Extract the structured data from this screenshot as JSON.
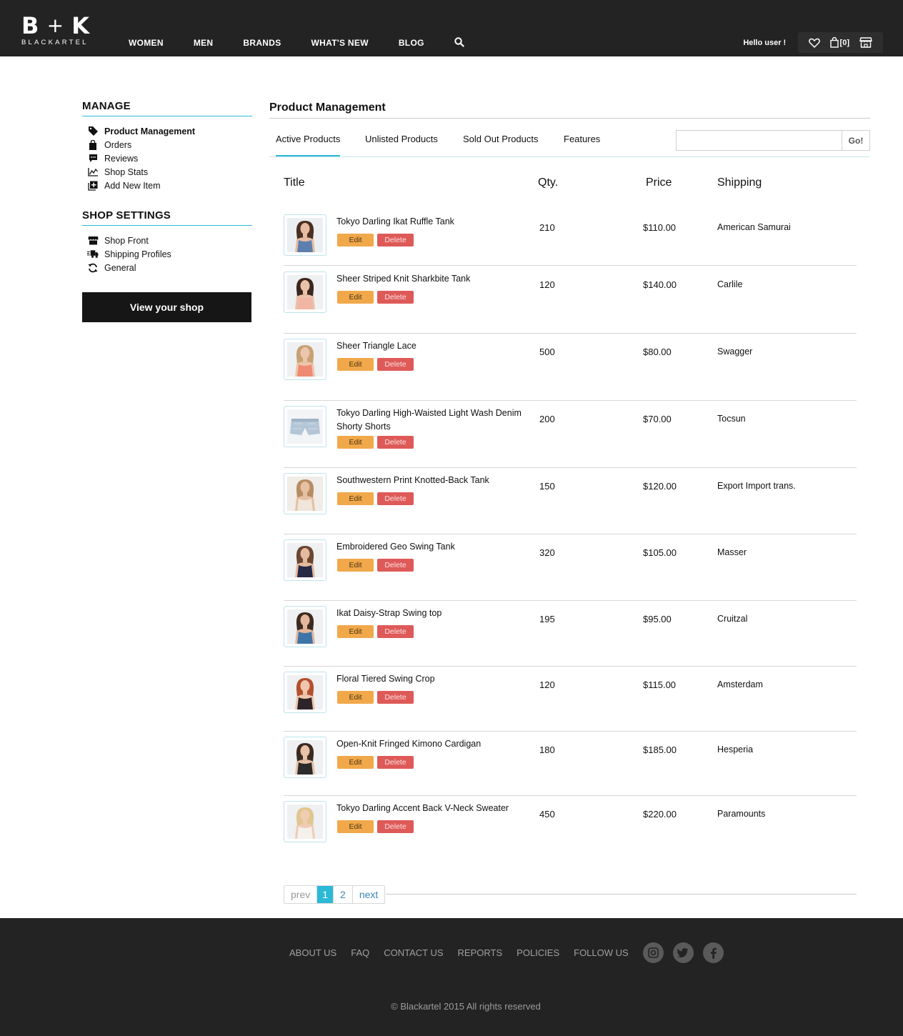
{
  "brand": {
    "mark_left": "B",
    "mark_plus": "+",
    "mark_right": "K",
    "wordmark": "BLACKARTEL"
  },
  "nav": {
    "items": [
      "WOMEN",
      "MEN",
      "BRANDS",
      "WHAT'S NEW",
      "BLOG"
    ],
    "search_icon": "search-icon"
  },
  "user": {
    "greeting": "Hello user !",
    "cart_count": "[0]"
  },
  "sidebar": {
    "manage_title": "MANAGE",
    "manage_items": [
      {
        "label": "Product Management",
        "icon": "tag-icon",
        "active": true
      },
      {
        "label": "Orders",
        "icon": "bag-icon"
      },
      {
        "label": "Reviews",
        "icon": "chat-icon"
      },
      {
        "label": "Shop Stats",
        "icon": "chart-icon"
      },
      {
        "label": "Add New Item",
        "icon": "add-icon"
      }
    ],
    "settings_title": "SHOP SETTINGS",
    "settings_items": [
      {
        "label": "Shop Front",
        "icon": "storefront-icon"
      },
      {
        "label": "Shipping Profiles",
        "icon": "truck-icon"
      },
      {
        "label": "General",
        "icon": "refresh-icon"
      }
    ],
    "view_shop_label": "View your shop"
  },
  "main": {
    "title": "Product Management",
    "tabs": [
      "Active Products",
      "Unlisted Products",
      "Sold Out Products",
      "Features"
    ],
    "active_tab": "Active Products",
    "search": {
      "value": "",
      "button_label": "Go!"
    },
    "columns": {
      "title": "Title",
      "qty": "Qty.",
      "price": "Price",
      "shipping": "Shipping"
    },
    "edit_label": "Edit",
    "delete_label": "Delete",
    "products": [
      {
        "name": "Tokyo Darling Ikat Ruffle Tank",
        "qty": "210",
        "price": "$110.00",
        "shipping": "American Samurai",
        "thumb": "model-blue-top"
      },
      {
        "name": "Sheer Striped Knit Sharkbite Tank",
        "qty": "120",
        "price": "$140.00",
        "shipping": "Carlile",
        "thumb": "model-peach-top"
      },
      {
        "name": "Sheer Triangle Lace",
        "qty": "500",
        "price": "$80.00",
        "shipping": "Swagger",
        "thumb": "model-coral-bra"
      },
      {
        "name": "Tokyo Darling High-Waisted Light Wash Denim Shorty Shorts",
        "qty": "200",
        "price": "$70.00",
        "shipping": "Tocsun",
        "thumb": "denim-shorts"
      },
      {
        "name": "Southwestern Print Knotted-Back Tank",
        "qty": "150",
        "price": "$120.00",
        "shipping": "Export Import trans.",
        "thumb": "model-white-back"
      },
      {
        "name": "Embroidered Geo Swing Tank",
        "qty": "320",
        "price": "$105.00",
        "shipping": "Masser",
        "thumb": "model-navy-tank"
      },
      {
        "name": "Ikat Daisy-Strap Swing top",
        "qty": "195",
        "price": "$95.00",
        "shipping": "Cruitzal",
        "thumb": "model-blue-print"
      },
      {
        "name": "Floral Tiered Swing Crop",
        "qty": "120",
        "price": "$115.00",
        "shipping": "Amsterdam",
        "thumb": "model-floral-crop"
      },
      {
        "name": "Open-Knit Fringed Kimono Cardigan",
        "qty": "180",
        "price": "$185.00",
        "shipping": "Hesperia",
        "thumb": "model-black-cardigan"
      },
      {
        "name": "Tokyo Darling Accent Back V-Neck Sweater",
        "qty": "450",
        "price": "$220.00",
        "shipping": "Paramounts",
        "thumb": "model-white-sweater"
      }
    ],
    "pagination": {
      "prev": "prev",
      "pages": [
        "1",
        "2"
      ],
      "current": "1",
      "next": "next"
    }
  },
  "footer": {
    "links": [
      "ABOUT US",
      "FAQ",
      "CONTACT US",
      "REPORTS",
      "POLICIES",
      "FOLLOW US"
    ],
    "social_icons": [
      "instagram-icon",
      "twitter-icon",
      "facebook-icon"
    ],
    "copyright": "© Blackartel 2015 All rights reserved"
  },
  "colors": {
    "header_bg": "#232323",
    "accent": "#2bb9d6",
    "edit": "#f1a84a",
    "delete": "#de5a58"
  }
}
